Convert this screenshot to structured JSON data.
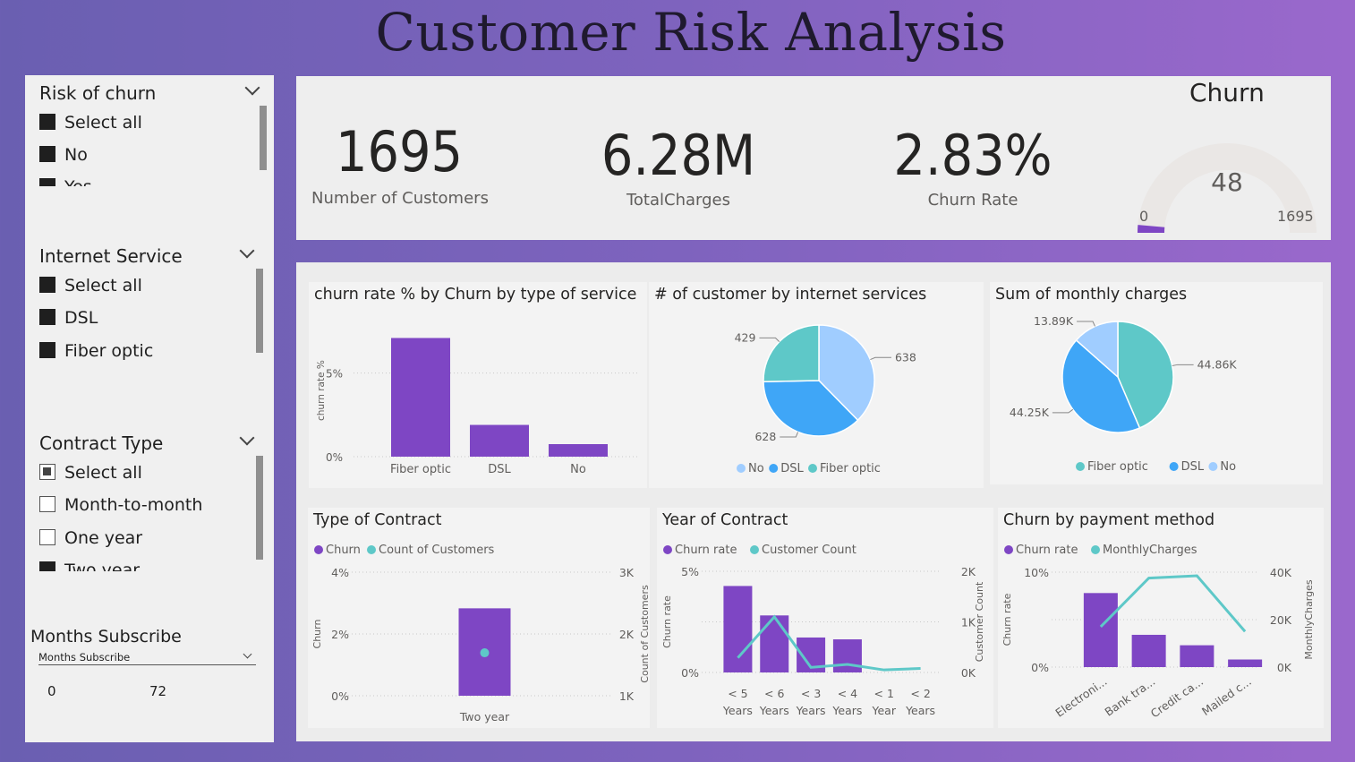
{
  "title": "Customer Risk Analysis",
  "slicers": {
    "risk": {
      "title": "Risk of churn",
      "options": [
        "Select all",
        "No",
        "Yes"
      ]
    },
    "internet": {
      "title": "Internet Service",
      "options": [
        "Select all",
        "DSL",
        "Fiber optic"
      ]
    },
    "contract": {
      "title": "Contract Type",
      "options": [
        "Select all",
        "Month-to-month",
        "One year",
        "Two year"
      ]
    },
    "months": {
      "title": "Months Subscribe",
      "field": "Months Subscribe",
      "min": "0",
      "max": "72"
    }
  },
  "kpis": {
    "customers": {
      "value": "1695",
      "label": "Number of Customers"
    },
    "charges": {
      "value": "6.28M",
      "label": "TotalCharges"
    },
    "churn_rate": {
      "value": "2.83%",
      "label": "Churn Rate"
    }
  },
  "gauge": {
    "title": "Churn",
    "value": "48",
    "min": "0",
    "max": "1695"
  },
  "colors": {
    "purple": "#7e46c4",
    "teal": "#5ec8c8",
    "blue": "#3fa6f7",
    "lightblue": "#a0cdff"
  },
  "chart_data": [
    {
      "id": "churn_by_service",
      "type": "bar",
      "title": "churn rate % by Churn by type of service",
      "ylabel": "churn rate %",
      "categories": [
        "Fiber optic",
        "DSL",
        "No"
      ],
      "values": [
        7.1,
        1.9,
        0.75
      ],
      "yticks": [
        "0%",
        "5%"
      ],
      "ylim": [
        0,
        7.5
      ]
    },
    {
      "id": "customers_by_internet",
      "type": "pie",
      "title": "# of customer by internet services",
      "slices": [
        {
          "label": "Fiber optic",
          "value": 638,
          "value_label": "638",
          "color": "#a0cdff"
        },
        {
          "label": "DSL",
          "value": 628,
          "value_label": "628",
          "color": "#3fa6f7"
        },
        {
          "label": "No",
          "value": 429,
          "value_label": "429",
          "color": "#5ec8c8"
        }
      ],
      "legend": [
        {
          "label": "No",
          "color": "#a0cdff"
        },
        {
          "label": "DSL",
          "color": "#3fa6f7"
        },
        {
          "label": "Fiber optic",
          "color": "#5ec8c8"
        }
      ]
    },
    {
      "id": "monthly_charges",
      "type": "pie",
      "title": "Sum of monthly charges",
      "slices": [
        {
          "label": "Fiber optic",
          "value": 44.86,
          "value_label": "44.86K",
          "color": "#5ec8c8"
        },
        {
          "label": "DSL",
          "value": 44.25,
          "value_label": "44.25K",
          "color": "#3fa6f7"
        },
        {
          "label": "No",
          "value": 13.89,
          "value_label": "13.89K",
          "color": "#a0cdff"
        }
      ],
      "legend": [
        {
          "label": "Fiber optic",
          "color": "#5ec8c8"
        },
        {
          "label": "DSL",
          "color": "#3fa6f7"
        },
        {
          "label": "No",
          "color": "#a0cdff"
        }
      ]
    },
    {
      "id": "type_of_contract",
      "type": "bar",
      "title": "Type of Contract",
      "legend": [
        {
          "label": "Churn",
          "color": "#7e46c4"
        },
        {
          "label": "Count of Customers",
          "color": "#5ec8c8"
        }
      ],
      "categories": [
        "Two year"
      ],
      "series": [
        {
          "name": "Churn",
          "values": [
            2.83
          ],
          "axis": "left"
        },
        {
          "name": "Count of Customers",
          "values": [
            1695
          ],
          "axis": "right"
        }
      ],
      "ylabel": "Churn",
      "y2label": "Count of Customers",
      "yticks": [
        "0%",
        "2%",
        "4%"
      ],
      "y2ticks": [
        "1K",
        "2K",
        "3K"
      ],
      "ylim": [
        0,
        4
      ],
      "y2lim": [
        1000,
        3000
      ]
    },
    {
      "id": "year_of_contract",
      "type": "bar",
      "title": "Year of Contract",
      "legend": [
        {
          "label": "Churn rate",
          "color": "#7e46c4"
        },
        {
          "label": "Customer Count",
          "color": "#5ec8c8"
        }
      ],
      "categories": [
        [
          "< 5",
          "Years"
        ],
        [
          "< 6",
          "Years"
        ],
        [
          "< 3",
          "Years"
        ],
        [
          "< 4",
          "Years"
        ],
        [
          "< 1",
          "Year"
        ],
        [
          "< 2",
          "Years"
        ]
      ],
      "series": [
        {
          "name": "Churn rate",
          "values": [
            4.7,
            3.1,
            1.9,
            1.8,
            0,
            0
          ],
          "axis": "left"
        },
        {
          "name": "Customer Count",
          "values": [
            290,
            1100,
            100,
            160,
            50,
            80
          ],
          "axis": "right"
        }
      ],
      "ylabel": "Churn rate",
      "y2label": "Customer Count",
      "yticks": [
        "0%",
        "5%"
      ],
      "y2ticks": [
        "0K",
        "1K",
        "2K"
      ],
      "ylim": [
        0,
        5.5
      ],
      "y2lim": [
        0,
        2000
      ]
    },
    {
      "id": "churn_by_payment",
      "type": "bar",
      "title": "Churn by payment method",
      "legend": [
        {
          "label": "Churn rate",
          "color": "#7e46c4"
        },
        {
          "label": "MonthlyCharges",
          "color": "#5ec8c8"
        }
      ],
      "categories": [
        "Electroni...",
        "Bank tra...",
        "Credit ca...",
        "Mailed c..."
      ],
      "series": [
        {
          "name": "Churn rate",
          "values": [
            7.8,
            3.4,
            2.3,
            0.8
          ],
          "axis": "left"
        },
        {
          "name": "MonthlyCharges",
          "values": [
            17000,
            37500,
            38500,
            15000
          ],
          "axis": "right"
        }
      ],
      "ylabel": "Churn rate",
      "y2label": "MonthlyCharges",
      "yticks": [
        "0%",
        "10%"
      ],
      "y2ticks": [
        "0K",
        "20K",
        "40K"
      ],
      "ylim": [
        0,
        10
      ],
      "y2lim": [
        0,
        40000
      ]
    }
  ]
}
